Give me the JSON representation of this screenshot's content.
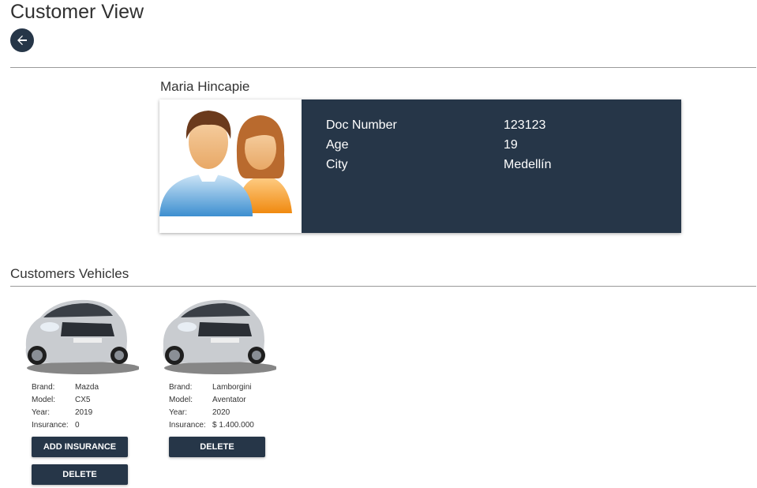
{
  "page": {
    "title": "Customer View"
  },
  "customer": {
    "name": "Maria Hincapie",
    "fields": [
      {
        "label": "Doc Number",
        "value": "123123"
      },
      {
        "label": "Age",
        "value": "19"
      },
      {
        "label": "City",
        "value": "Medellín"
      }
    ]
  },
  "vehicles_section": {
    "title": "Customers Vehicles"
  },
  "vehicles": [
    {
      "brand_label": "Brand:",
      "brand": "Mazda",
      "model_label": "Model:",
      "model": "CX5",
      "year_label": "Year:",
      "year": "2019",
      "insurance_label": "Insurance:",
      "insurance": "0",
      "add_insurance_label": "ADD INSURANCE",
      "delete_label": "DELETE"
    },
    {
      "brand_label": "Brand:",
      "brand": "Lamborgini",
      "model_label": "Model:",
      "model": "Aventator",
      "year_label": "Year:",
      "year": "2020",
      "insurance_label": "Insurance:",
      "insurance": "$ 1.400.000",
      "delete_label": "DELETE"
    }
  ],
  "colors": {
    "accent": "#263648",
    "divider": "#9a9a9a"
  }
}
